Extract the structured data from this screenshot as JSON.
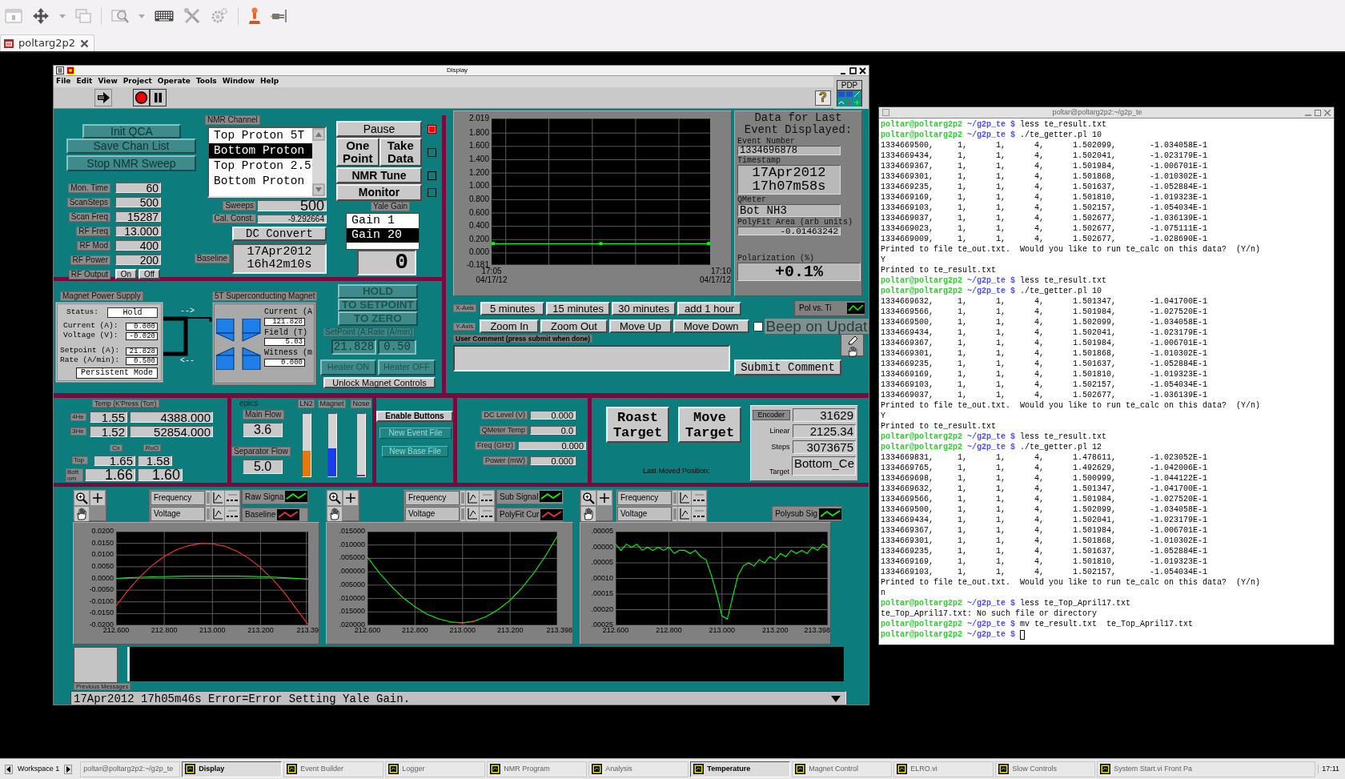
{
  "viewer": {
    "tab": {
      "label": "poltarg2p2",
      "selected": true
    }
  },
  "display": {
    "title": "Display",
    "menu": [
      "File",
      "Edit",
      "View",
      "Project",
      "Operate",
      "Tools",
      "Window",
      "Help"
    ],
    "help": "?",
    "vi_icon": "PDP",
    "nmr": {
      "actions": [
        "Init QCA",
        "Save Chan List",
        "Stop NMR Sweep"
      ],
      "settings": [
        {
          "label": "Mon. Time",
          "value": "60"
        },
        {
          "label": "ScanSteps",
          "value": "500"
        },
        {
          "label": "Scan Freq",
          "value": "15287"
        },
        {
          "label": "RF Freq",
          "value": "13.000"
        },
        {
          "label": "RF Mod",
          "value": "400"
        },
        {
          "label": "RF Power",
          "value": "200"
        }
      ],
      "rf_output": {
        "label": "RF Output",
        "options": [
          "On",
          "Off"
        ]
      },
      "channel": {
        "label": "NMR Channel",
        "items": [
          {
            "text": "Top Proton 5T",
            "selected": false
          },
          {
            "text": "Bottom Proton",
            "selected": true
          },
          {
            "text": "Top Proton 2.5",
            "selected": false
          },
          {
            "text": "Bottom Proton",
            "selected": false
          }
        ]
      },
      "sweeps": {
        "label": "Sweeps",
        "value": "500"
      },
      "cal_const": {
        "label": "Cal. Const.",
        "value": "-9.292664"
      },
      "convert": "DC Convert",
      "baseline": {
        "label": "Baseline",
        "value": "17Apr2012 16h42m10s"
      },
      "controls": [
        {
          "buttons": [
            "Pause"
          ],
          "led_on": true
        },
        {
          "buttons": [
            "One Point",
            "Take Data"
          ],
          "led_on": false
        },
        {
          "buttons": [
            "NMR Tune"
          ],
          "led_on": false
        },
        {
          "buttons": [
            "Monitor"
          ],
          "led_on": false
        }
      ],
      "gain": {
        "label": "Yale Gain",
        "items": [
          {
            "text": "Gain 1",
            "selected": false
          },
          {
            "text": "Gain 20",
            "selected": true
          }
        ],
        "reading": "0"
      }
    },
    "magnet": {
      "supply": {
        "label": "Magnet Power Supply",
        "status_label": "Status:",
        "status": "Hold",
        "readings": [
          {
            "label": "Current (A):",
            "value": "0.000"
          },
          {
            "label": "Voltage (V):",
            "value": "-0.020"
          },
          {
            "label": "Setpoint (A):",
            "value": "21.828"
          },
          {
            "label": "Rate (A/min):",
            "value": "0.500"
          }
        ],
        "button": "Persistent Mode"
      },
      "flow_out": "-->",
      "flow_in": "<--",
      "coil": {
        "label": "5T Superconducting Magnet",
        "readings": [
          {
            "label": "Current (A",
            "value": "121.828"
          },
          {
            "label": "Field (T)",
            "value": "5.03"
          },
          {
            "label": "Witness (m",
            "value": "0.000"
          }
        ]
      },
      "ramp_buttons": [
        {
          "label": "HOLD",
          "disabled": true
        },
        {
          "label": "TO SETPOINT",
          "disabled": true
        },
        {
          "label": "TO ZERO",
          "disabled": true
        }
      ],
      "setpoint_label": "SetPoint (A:Rate (A/min)",
      "setpoints": [
        {
          "value": "21.828",
          "disabled": true
        },
        {
          "value": "0.50",
          "disabled": true
        }
      ],
      "heater_buttons": [
        {
          "label": "Heater ON",
          "disabled": true
        },
        {
          "label": "Heater OFF",
          "disabled": true
        }
      ],
      "unlock": {
        "label": "Unlock Magnet Controls",
        "disabled": false
      }
    },
    "trend": {
      "chart_data": {
        "type": "line",
        "grid": true,
        "categories": [
          "17:05 04/17/12",
          null,
          "17:10 04/17/12"
        ],
        "series": [
          {
            "name": "Pol vs. Ti",
            "color": "#00ff00",
            "marker": true,
            "values": [
              0.14,
              0.14,
              0.14
            ]
          }
        ],
        "ylim": [
          -0.181,
          2.019
        ],
        "yticks": [
          {
            "value": 2.019,
            "label": "2.019"
          },
          {
            "value": 1.8,
            "label": "1.800"
          },
          {
            "value": 1.6,
            "label": "1.600"
          },
          {
            "value": 1.4,
            "label": "1.400"
          },
          {
            "value": 1.2,
            "label": "1.200"
          },
          {
            "value": 1.0,
            "label": "1.000"
          },
          {
            "value": 0.8,
            "label": "0.800"
          },
          {
            "value": 0.6,
            "label": "0.600"
          },
          {
            "value": 0.4,
            "label": "0.400"
          },
          {
            "value": 0.2,
            "label": "0.200"
          },
          {
            "value": 0.0,
            "label": "0.000"
          },
          {
            "value": -0.181,
            "label": "-0.181"
          }
        ]
      }
    },
    "last_event": {
      "title": "Data for Last Event Displayed:",
      "fields": [
        {
          "label": "Event Number",
          "value": "1334696878",
          "kind": "id"
        },
        {
          "label": "Timestamp",
          "value": "17Apr2012 17h07m58s",
          "kind": "stamp"
        },
        {
          "label": "QMeter",
          "value": "Bot NH3",
          "kind": "text"
        },
        {
          "label": "PolyFit Area (arb units)",
          "value": "-0.01463242",
          "kind": "number"
        },
        {
          "label": "Polarization (%)",
          "value": "+0.1%",
          "kind": "reading"
        }
      ]
    },
    "x_axis": {
      "label": "X-Axis",
      "buttons": [
        "5 minutes",
        "15 minutes",
        "30 minutes",
        "add 1 hour"
      ]
    },
    "y_axis": {
      "label": "Y-Axis",
      "buttons": [
        "Zoom In",
        "Zoom Out",
        "Move Up",
        "Move Down"
      ]
    },
    "beep": {
      "label": "Beep on Updat",
      "checked": false
    },
    "comment": {
      "label": "User Comment (press submit when done)",
      "button": "Submit Comment"
    },
    "cryo": {
      "temps": {
        "label": "Temp (K'Press (Torr)",
        "rows": [
          {
            "label": "4He",
            "values": [
              "1.55",
              "4388.000"
            ]
          },
          {
            "label": "3He",
            "values": [
              "1.52",
              "52854.000"
            ]
          }
        ],
        "columns": [
          "Cx",
          "RuO"
        ],
        "sensors": [
          {
            "label": "Top",
            "values": [
              "1.65",
              "1.58"
            ]
          },
          {
            "label": "Bottom",
            "values": [
              "1.66",
              "1.60"
            ]
          }
        ]
      },
      "flows": {
        "caption": "epics",
        "items": [
          {
            "label": "Main Flow",
            "value": "3.6"
          },
          {
            "label": "Separator Flow",
            "value": "5.0"
          }
        ]
      },
      "levels": [
        {
          "label": "LN2",
          "level": 0.41,
          "color": "#e8780c"
        },
        {
          "label": "Magnet",
          "level": 0.45,
          "color": "#1c3cf0"
        },
        {
          "label": "Nose",
          "level": 0.02,
          "color": "#7030a0"
        }
      ]
    },
    "files": [
      {
        "label": "Enable Buttons",
        "disabled": false
      },
      {
        "label": "New Event File",
        "disabled": true
      },
      {
        "label": "New Base File",
        "disabled": true
      }
    ],
    "qmeter": [
      {
        "label": "DC Level (V)",
        "value": "0.000"
      },
      {
        "label": "QMeter Temp",
        "value": "0.0"
      },
      {
        "label": "Freq (GHz)",
        "value": "0.000"
      },
      {
        "label": "Power (mW)",
        "value": "0.000"
      }
    ],
    "target": {
      "buttons": [
        "Roast Target",
        "Move Target"
      ],
      "caption": "Last Moved Position:",
      "readings": [
        {
          "label": "Encoder",
          "value": "31629"
        },
        {
          "label": "Linear",
          "value": "2125.34"
        },
        {
          "label": "Steps",
          "value": "3073675"
        },
        {
          "label": "Target",
          "value": "Bottom_Ce"
        }
      ]
    },
    "signal_plots": [
      {
        "axes": [
          "Frequency",
          "Voltage"
        ],
        "chart_data": {
          "type": "line",
          "grid": true,
          "x": [
            212.6,
            212.65,
            212.7,
            212.75,
            212.8,
            212.85,
            212.9,
            212.95,
            213.0,
            213.05,
            213.1,
            213.15,
            213.2,
            213.25,
            213.3,
            213.35,
            213.398
          ],
          "series": [
            {
              "name": "Raw Signa",
              "color": "#00ff00",
              "values": [
                0.0,
                0.0003,
                0.0005,
                0.0007,
                0.0008,
                0.0009,
                0.001,
                0.001,
                0.001,
                0.001,
                0.001,
                0.0009,
                0.0008,
                0.0006,
                0.0003,
                0.0,
                -0.0004
              ]
            },
            {
              "name": "Baseline",
              "color": "#ff3030",
              "values": [
                -0.0117,
                -0.005,
                0.0008,
                0.0056,
                0.0094,
                0.0122,
                0.014,
                0.0149,
                0.0148,
                0.0138,
                0.0117,
                0.0087,
                0.0047,
                -0.0003,
                -0.0062,
                -0.0132,
                -0.0197
              ]
            }
          ],
          "xlim": [
            212.6,
            213.398
          ],
          "ylim": [
            -0.02,
            0.02
          ],
          "xticks": [
            {
              "value": 212.6,
              "label": "212.600"
            },
            {
              "value": 212.8,
              "label": "212.800"
            },
            {
              "value": 213.0,
              "label": "213.000"
            },
            {
              "value": 213.2,
              "label": "213.200"
            },
            {
              "value": 213.39,
              "label": "213.39"
            }
          ],
          "yticks": [
            {
              "value": 0.02,
              "label": "0.0200"
            },
            {
              "value": 0.015,
              "label": "0.0150"
            },
            {
              "value": 0.01,
              "label": "0.0100"
            },
            {
              "value": 0.005,
              "label": "0.0050"
            },
            {
              "value": 0.0,
              "label": "0.0000"
            },
            {
              "value": -0.005,
              "label": "-0.0050"
            },
            {
              "value": -0.01,
              "label": "-0.0100"
            },
            {
              "value": -0.015,
              "label": "-0.0150"
            },
            {
              "value": -0.02,
              "label": "-0.0200"
            }
          ]
        }
      },
      {
        "axes": [
          "Frequency",
          "Voltage"
        ],
        "chart_data": {
          "type": "line",
          "grid": true,
          "x": [
            212.6,
            212.65,
            212.7,
            212.75,
            212.8,
            212.85,
            212.9,
            212.95,
            213.0,
            213.05,
            213.1,
            213.15,
            213.2,
            213.25,
            213.3,
            213.35,
            213.398
          ],
          "series": [
            {
              "name": "Sub Signal",
              "color": "#00ff00",
              "values": [
                0.0054,
                -0.0004,
                -0.0054,
                -0.0097,
                -0.0131,
                -0.0158,
                -0.0176,
                -0.0187,
                -0.019,
                -0.0184,
                -0.0167,
                -0.0141,
                -0.0106,
                -0.006,
                -0.0004,
                0.0061,
                0.0133
              ]
            },
            {
              "name": "PolyFit Cur",
              "color": "#ff3030",
              "values": [
                null,
                null,
                null,
                null,
                null,
                null,
                null,
                -0.0189,
                -0.0192,
                -0.0186,
                null,
                null,
                null,
                null,
                null,
                null,
                null
              ]
            }
          ],
          "xlim": [
            212.6,
            213.398
          ],
          "ylim": [
            -0.02,
            0.015
          ],
          "xticks": [
            {
              "value": 212.6,
              "label": "212.600"
            },
            {
              "value": 212.8,
              "label": "212.800"
            },
            {
              "value": 213.0,
              "label": "213.000"
            },
            {
              "value": 213.2,
              "label": "213.200"
            },
            {
              "value": 213.398,
              "label": "213.398"
            }
          ],
          "yticks": [
            {
              "value": 0.015,
              "label": ".015000"
            },
            {
              "value": 0.01,
              "label": ".010000"
            },
            {
              "value": 0.005,
              "label": ".005000"
            },
            {
              "value": 0.0,
              "label": ".000000"
            },
            {
              "value": -0.005,
              "label": ".005000"
            },
            {
              "value": -0.01,
              "label": ".010000"
            },
            {
              "value": -0.015,
              "label": ".015000"
            },
            {
              "value": -0.02,
              "label": ".020000"
            }
          ]
        }
      },
      {
        "axes": [
          "Frequency",
          "Voltage"
        ],
        "chart_data": {
          "type": "line",
          "grid": true,
          "x": [
            212.6,
            212.62,
            212.64,
            212.66,
            212.68,
            212.7,
            212.72,
            212.74,
            212.76,
            212.78,
            212.8,
            212.82,
            212.84,
            212.86,
            212.88,
            212.9,
            212.92,
            212.94,
            212.96,
            212.98,
            213.0,
            213.02,
            213.04,
            213.06,
            213.08,
            213.1,
            213.12,
            213.14,
            213.16,
            213.18,
            213.2,
            213.22,
            213.24,
            213.26,
            213.28,
            213.3,
            213.32,
            213.34,
            213.36,
            213.38,
            213.398
          ],
          "series": [
            {
              "name": "Polysub Sig",
              "color": "#00ff00",
              "values": [
                1e-05,
                -1e-05,
                1e-05,
                0.0,
                1e-05,
                -1e-05,
                0.0,
                -1e-05,
                0.0,
                -1e-05,
                0.0,
                -2e-05,
                -1e-05,
                -1e-05,
                -2e-05,
                -1e-05,
                -3e-05,
                -4e-05,
                -9e-05,
                -0.00015,
                -0.00022,
                -0.00023,
                -0.00016,
                -9e-05,
                -6e-05,
                -5e-05,
                -6e-05,
                -4e-05,
                -5e-05,
                -3e-05,
                -4e-05,
                -2e-05,
                -3e-05,
                -1e-05,
                -2e-05,
                -1e-05,
                -2e-05,
                0.0,
                -1e-05,
                1e-05,
                0.0
              ]
            }
          ],
          "xlim": [
            212.6,
            213.398
          ],
          "ylim": [
            -0.00025,
            5e-05
          ],
          "xticks": [
            {
              "value": 212.6,
              "label": "212.600"
            },
            {
              "value": 212.8,
              "label": "212.800"
            },
            {
              "value": 213.0,
              "label": "213.000"
            },
            {
              "value": 213.2,
              "label": "213.200"
            },
            {
              "value": 213.398,
              "label": "213.398"
            }
          ],
          "yticks": [
            {
              "value": 5e-05,
              "label": ".00005"
            },
            {
              "value": 0.0,
              "label": ".00000"
            },
            {
              "value": -5e-05,
              "label": ".00005"
            },
            {
              "value": -0.0001,
              "label": ".00010"
            },
            {
              "value": -0.00015,
              "label": ".00015"
            },
            {
              "value": -0.0002,
              "label": ".00020"
            },
            {
              "value": -0.00025,
              "label": ".00025"
            }
          ]
        }
      }
    ],
    "messages": {
      "label": "Previous Messages",
      "latest": "17Apr2012 17h05m46s Error=Error Setting Yale Gain."
    }
  },
  "terminal": {
    "title": "poltar@poltarg2p2:~/g2p_te",
    "cursor": true,
    "lines": [
      {
        "kind": "prompt",
        "user": "poltar@poltarg2p2",
        "path": "~/g2p_te $",
        "command": "less te_result.txt"
      },
      {
        "kind": "prompt",
        "user": "poltar@poltarg2p2",
        "path": "~/g2p_te $",
        "command": "./te_getter.pl 10"
      },
      {
        "kind": "output",
        "text": "1334669500,     1,      1,      4,      1.502099,       -1.034058E-1"
      },
      {
        "kind": "output",
        "text": "1334669434,     1,      1,      4,      1.502041,       -1.023179E-1"
      },
      {
        "kind": "output",
        "text": "1334669367,     1,      1,      4,      1.501984,       -1.006701E-1"
      },
      {
        "kind": "output",
        "text": "1334669301,     1,      1,      4,      1.501868,       -1.010302E-1"
      },
      {
        "kind": "output",
        "text": "1334669235,     1,      1,      4,      1.501637,       -1.052884E-1"
      },
      {
        "kind": "output",
        "text": "1334669169,     1,      1,      4,      1.501810,       -1.019323E-1"
      },
      {
        "kind": "output",
        "text": "1334669103,     1,      1,      4,      1.502157,       -1.054034E-1"
      },
      {
        "kind": "output",
        "text": "1334669037,     1,      1,      4,      1.502677,       -1.036139E-1"
      },
      {
        "kind": "output",
        "text": "1334669023,     1,      1,      4,      1.502677,       -1.075111E-1"
      },
      {
        "kind": "output",
        "text": "1334669009,     1,      1,      4,      1.502677,       -1.028690E-1"
      },
      {
        "kind": "output",
        "text": "Printed to file te_out.txt.  Would you like to run te_calc on this data?  (Y/n)"
      },
      {
        "kind": "output",
        "text": "Y"
      },
      {
        "kind": "output",
        "text": "Printed to te_result.txt"
      },
      {
        "kind": "prompt",
        "user": "poltar@poltarg2p2",
        "path": "~/g2p_te $",
        "command": "less te_result.txt"
      },
      {
        "kind": "prompt",
        "user": "poltar@poltarg2p2",
        "path": "~/g2p_te $",
        "command": "./te_getter.pl 10"
      },
      {
        "kind": "output",
        "text": "1334669632,     1,      1,      4,      1.501347,       -1.041700E-1"
      },
      {
        "kind": "output",
        "text": "1334669566,     1,      1,      4,      1.501984,       -1.027520E-1"
      },
      {
        "kind": "output",
        "text": "1334669500,     1,      1,      4,      1.502099,       -1.034058E-1"
      },
      {
        "kind": "output",
        "text": "1334669434,     1,      1,      4,      1.502041,       -1.023179E-1"
      },
      {
        "kind": "output",
        "text": "1334669367,     1,      1,      4,      1.501984,       -1.006701E-1"
      },
      {
        "kind": "output",
        "text": "1334669301,     1,      1,      4,      1.501868,       -1.010302E-1"
      },
      {
        "kind": "output",
        "text": "1334669235,     1,      1,      4,      1.501637,       -1.052884E-1"
      },
      {
        "kind": "output",
        "text": "1334669169,     1,      1,      4,      1.501810,       -1.019323E-1"
      },
      {
        "kind": "output",
        "text": "1334669103,     1,      1,      4,      1.502157,       -1.054034E-1"
      },
      {
        "kind": "output",
        "text": "1334669037,     1,      1,      4,      1.502677,       -1.036139E-1"
      },
      {
        "kind": "output",
        "text": "Printed to file te_out.txt.  Would you like to run te_calc on this data?  (Y/n)"
      },
      {
        "kind": "output",
        "text": "Y"
      },
      {
        "kind": "output",
        "text": "Printed to te_result.txt"
      },
      {
        "kind": "prompt",
        "user": "poltar@poltarg2p2",
        "path": "~/g2p_te $",
        "command": "less te_result.txt"
      },
      {
        "kind": "prompt",
        "user": "poltar@poltarg2p2",
        "path": "~/g2p_te $",
        "command": "./te_getter.pl 12"
      },
      {
        "kind": "output",
        "text": "1334669831,     1,      1,      4,      1.478611,       -1.023052E-1"
      },
      {
        "kind": "output",
        "text": "1334669765,     1,      1,      4,      1.492629,       -1.042006E-1"
      },
      {
        "kind": "output",
        "text": "1334669698,     1,      1,      4,      1.500999,       -1.044122E-1"
      },
      {
        "kind": "output",
        "text": "1334669632,     1,      1,      4,      1.501347,       -1.041700E-1"
      },
      {
        "kind": "output",
        "text": "1334669566,     1,      1,      4,      1.501984,       -1.027520E-1"
      },
      {
        "kind": "output",
        "text": "1334669500,     1,      1,      4,      1.502099,       -1.034058E-1"
      },
      {
        "kind": "output",
        "text": "1334669434,     1,      1,      4,      1.502041,       -1.023179E-1"
      },
      {
        "kind": "output",
        "text": "1334669367,     1,      1,      4,      1.501984,       -1.006701E-1"
      },
      {
        "kind": "output",
        "text": "1334669301,     1,      1,      4,      1.501868,       -1.010302E-1"
      },
      {
        "kind": "output",
        "text": "1334669235,     1,      1,      4,      1.501637,       -1.052884E-1"
      },
      {
        "kind": "output",
        "text": "1334669169,     1,      1,      4,      1.501810,       -1.019323E-1"
      },
      {
        "kind": "output",
        "text": "1334669103,     1,      1,      4,      1.502157,       -1.054034E-1"
      },
      {
        "kind": "output",
        "text": "Printed to file te_out.txt.  Would you like to run te_calc on this data?  (Y/n)"
      },
      {
        "kind": "output",
        "text": "n"
      },
      {
        "kind": "prompt",
        "user": "poltar@poltarg2p2",
        "path": "~/g2p_te $",
        "command": "less te_Top_April17.txt"
      },
      {
        "kind": "output",
        "text": "te_Top_April17.txt: No such file or directory"
      },
      {
        "kind": "prompt",
        "user": "poltar@poltarg2p2",
        "path": "~/g2p_te $",
        "command": "mv te_result.txt  te_Top_April17.txt"
      },
      {
        "kind": "prompt",
        "user": "poltar@poltarg2p2",
        "path": "~/g2p_te $"
      }
    ]
  },
  "taskbar": {
    "workspace": "Workspace 1",
    "clock": "17:11",
    "items": [
      {
        "label": "poltar@poltarg2p2:~/g2p_te",
        "kind": "plain",
        "selected": false
      },
      {
        "label": "Display",
        "kind": "app",
        "selected": true
      },
      {
        "label": "Event Builder",
        "kind": "app",
        "selected": false
      },
      {
        "label": "Logger",
        "kind": "app",
        "selected": false
      },
      {
        "label": "NMR Program",
        "kind": "app",
        "selected": false
      },
      {
        "label": "Analysis",
        "kind": "app",
        "selected": false
      },
      {
        "label": "Temperature",
        "kind": "app",
        "selected": true
      },
      {
        "label": "Magnet Control",
        "kind": "app",
        "selected": false
      },
      {
        "label": "ELRO.vi",
        "kind": "app",
        "selected": false
      },
      {
        "label": "Slow Controls",
        "kind": "app",
        "selected": false
      },
      {
        "label": "System Start.vi Front Pa",
        "kind": "app",
        "selected": false
      }
    ]
  }
}
